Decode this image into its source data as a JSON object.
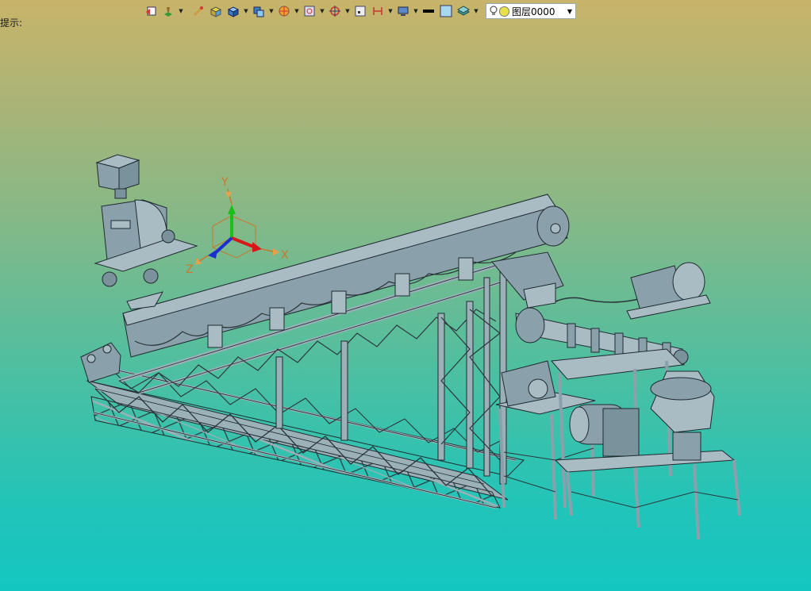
{
  "status": {
    "hint": "提示:"
  },
  "toolbar": {
    "buttons": [
      {
        "name": "undo-view-icon"
      },
      {
        "name": "fill-layer-icon",
        "dropdown": true
      },
      {
        "name": "brush-icon"
      },
      {
        "name": "box-yellow-icon"
      },
      {
        "name": "cube-blue-icon",
        "dropdown": true
      },
      {
        "name": "view-cube-icon",
        "dropdown": true
      },
      {
        "name": "render-wheel-icon",
        "dropdown": true
      },
      {
        "name": "zoom-window-icon",
        "dropdown": true
      },
      {
        "name": "target-icon",
        "dropdown": true
      },
      {
        "name": "frame-icon"
      },
      {
        "name": "dimension-icon",
        "dropdown": true
      },
      {
        "name": "monitor-icon",
        "dropdown": true
      },
      {
        "name": "line-black-icon"
      },
      {
        "name": "color-swatch-icon"
      },
      {
        "name": "layers-icon",
        "dropdown": true
      }
    ],
    "layer_select": {
      "value": "图层0000"
    }
  },
  "axes": {
    "x": "X",
    "y": "Y",
    "z": "Z"
  },
  "colors": {
    "metal_fill": "#8aa1ab",
    "metal_light": "#a9bcc4",
    "outline": "#1f2a30",
    "axis_x": "#d81818",
    "axis_y": "#18c018",
    "axis_z": "#1830d0",
    "axis_cube": "#c8782a"
  }
}
